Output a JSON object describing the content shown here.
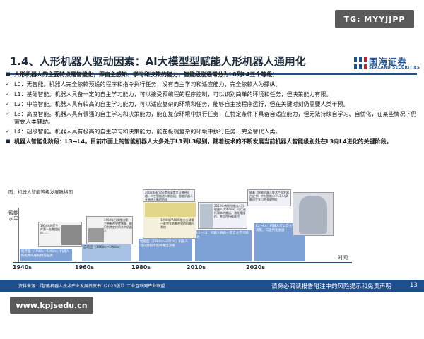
{
  "watermarks": {
    "top": "TG: MYYJJPP",
    "bottom": "www.kpjsedu.cn"
  },
  "header": {
    "title": "1.4、人形机器人驱动因素：AI大模型型赋能人形机器人通用化"
  },
  "logo": {
    "name_cn": "国海证券",
    "name_en": "SEALAND SECURITIES",
    "brand_color": "#1f4e8c"
  },
  "body": {
    "main_point": "人形机器人的主要特点是智能化，即自主感知、学习和决策的能力，智能级别通常分为L0到L4五个等级：",
    "levels": [
      "L0：无智能。机器人完全依赖预设的程序和指令执行任务，没有自主学习和适应能力，完全依赖人为操纵。",
      "L1：基础智能。机器人具备一定的自主学习能力，可以接受预编程的程序控制，可以识别简单的环境和任务，但决策能力有限。",
      "L2：中等智能。机器人具有较高的自主学习能力，可以适应复杂的环境和任务，能够自主按程序运行，但在关键时刻仍需要人类干预。",
      "L3：高度智能。机器人具有很强的自主学习和决策能力，能在复杂环境中执行任务，在特定条件下具备自适应能力，但无法持续自学习、自优化，在某些情况下仍需要人类辅助。",
      "L4：超级智能。机器人具有极高的自主学习和决策能力，能在极端复杂的环境中执行任务，完全替代人类。"
    ],
    "stage_point": "机器人智能化阶段：L3→L4。目前市面上的智能机器人大多处于L1到L3级别，随着技术的不断发展当前机器人智能级别处在L3向L4进化的关键阶段。"
  },
  "figure": {
    "caption": "图：机器人智能等级发展脉络图",
    "ylabel": "智能水平",
    "xlabel": "时间",
    "decades": [
      "1940s",
      "1960s",
      "1980s",
      "2010s",
      "2020s"
    ],
    "notes": {
      "n1954": "1954年MIT生产第一台数控机床……",
      "n1960": "1960年日本推出第一个带有视觉传感器、能识别并定位积木的机器人",
      "n1990": "1990年FANUC推出全球第一款完全依靠视觉的机器人系统",
      "n2006": "2006年Hinton提出深度学习神经网络，人工智能进入新阶段，智能机器人开始进入新的阶段",
      "n2022": "2022年特斯拉推出人形机器人Optimus，可以进行简单的搬运、浇花等操作，并且在持续迭代",
      "n2023": "随着《智能机器人技术产业发展白皮书》中对智能水平L1-L4具备自主学习的关键特征"
    },
    "stages": {
      "s1": "程序型（1940s～1960s）机器人按照预先编程执行任务",
      "s2": "自适应（1960s～1980s）",
      "s3": "智能型（1980s～2010s）机器人可以感知环境并做出决策",
      "s4": "L1～L3：机器人具备一定自主学习能力",
      "s5": "L3～L4：机器人可以自主学习和决策，向通用化发展"
    }
  },
  "footer": {
    "source": "资料来源：《智能机器人技术产业发展白皮书（2023版）》工业互联网产业联盟",
    "disclaimer": "请务必阅读报告附注中的风险提示和免责声明",
    "page": "13"
  }
}
